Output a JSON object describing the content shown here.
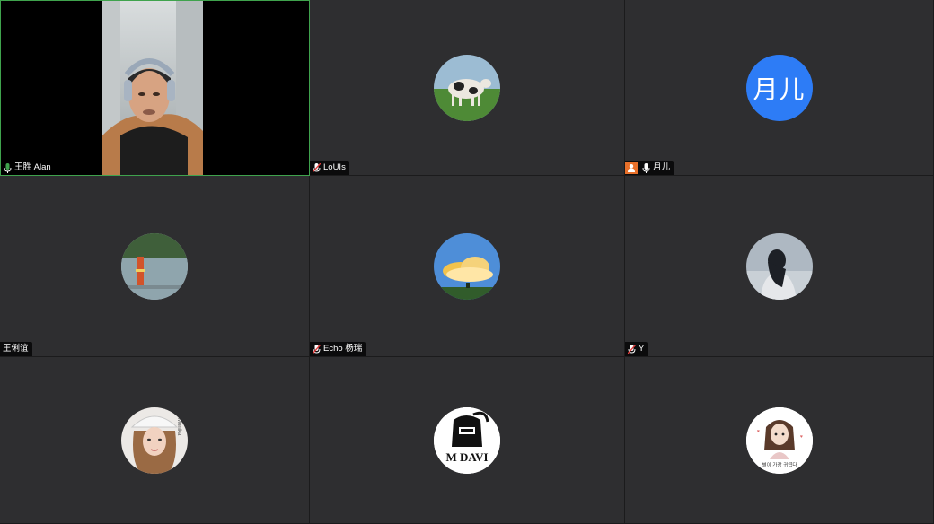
{
  "participants": [
    {
      "name": "王胜 Alan",
      "mic": "active",
      "video": true
    },
    {
      "name": "LoUIs",
      "mic": "muted",
      "avatar": "cow-photo"
    },
    {
      "name": "月儿",
      "mic": "unmuted",
      "host": true,
      "avatar_text": "月儿"
    },
    {
      "name": "王俐谊",
      "mic": "none",
      "avatar": "lake-photo"
    },
    {
      "name": "Echo 杨瑞",
      "mic": "muted",
      "avatar": "cloud-photo"
    },
    {
      "name": "Y",
      "mic": "muted",
      "avatar": "silhouette-photo"
    },
    {
      "name": "",
      "avatar": "portrait-photo",
      "avatar_side_text": "Monika"
    },
    {
      "name": "",
      "avatar": "knight-logo",
      "avatar_logo_text": "M DAVI"
    },
    {
      "name": "",
      "avatar": "girl-illustration",
      "avatar_caption": "별이 가장 귀엽다"
    }
  ],
  "colors": {
    "tile_bg": "#2e2e30",
    "active_speaker_border": "#3fa34d",
    "mic_active": "#3fa34d",
    "mic_muted": "#e23b3b",
    "avatar_blue": "#2d7cf6",
    "host_badge": "#e8702a"
  }
}
